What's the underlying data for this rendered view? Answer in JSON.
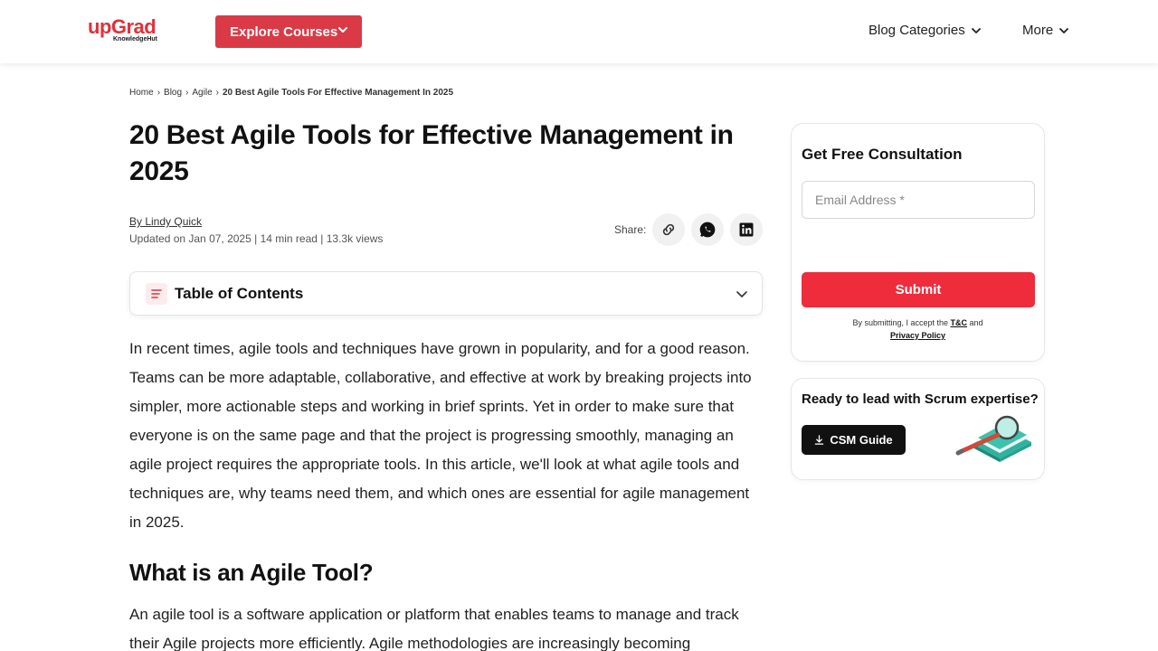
{
  "header": {
    "logo_main": "upGrad",
    "logo_sub": "KnowledgeHut",
    "explore_label": "Explore Courses",
    "nav_blog_categories": "Blog Categories",
    "nav_more": "More"
  },
  "breadcrumb": {
    "items": [
      "Home",
      "Blog",
      "Agile"
    ],
    "current": "20 Best Agile Tools For Effective Management In 2025"
  },
  "article": {
    "title": "20 Best Agile Tools for Effective Management in 2025",
    "author": "By Lindy Quick",
    "meta": "Updated on Jan 07, 2025 | 14 min read | 13.3k views",
    "share_label": "Share:",
    "toc_title": "Table of Contents",
    "intro": "In recent times, agile tools and techniques have grown in popularity, and for a good reason. Teams can be more adaptable, collaborative, and effective at work by breaking projects into simpler, more actionable steps and working in brief sprints. Yet in order to make sure that everyone is on the same page and that the project is progressing smoothly, managing an agile project requires the appropriate tools. In this article, we'll look at what agile tools and techniques are, why teams need them, and which ones are essential for agile management in 2025.",
    "h2": "What is an Agile Tool?",
    "para2": "An agile tool is a software application or platform that enables teams to manage and track their Agile projects more efficiently. Agile methodologies are increasingly becoming"
  },
  "sidebar": {
    "consult_title": "Get Free Consultation",
    "email_placeholder": "Email Address *",
    "submit_label": "Submit",
    "terms_prefix": "By submitting, I accept the",
    "terms_link": "T&C",
    "terms_and": "and",
    "privacy_link": "Privacy Policy",
    "scrum_title": "Ready to lead with Scrum expertise?",
    "csm_label": "CSM Guide"
  },
  "colors": {
    "brand_red": "#e1303a",
    "explore_bg": "#d93a46",
    "submit_bg": "#ee2c3c"
  }
}
